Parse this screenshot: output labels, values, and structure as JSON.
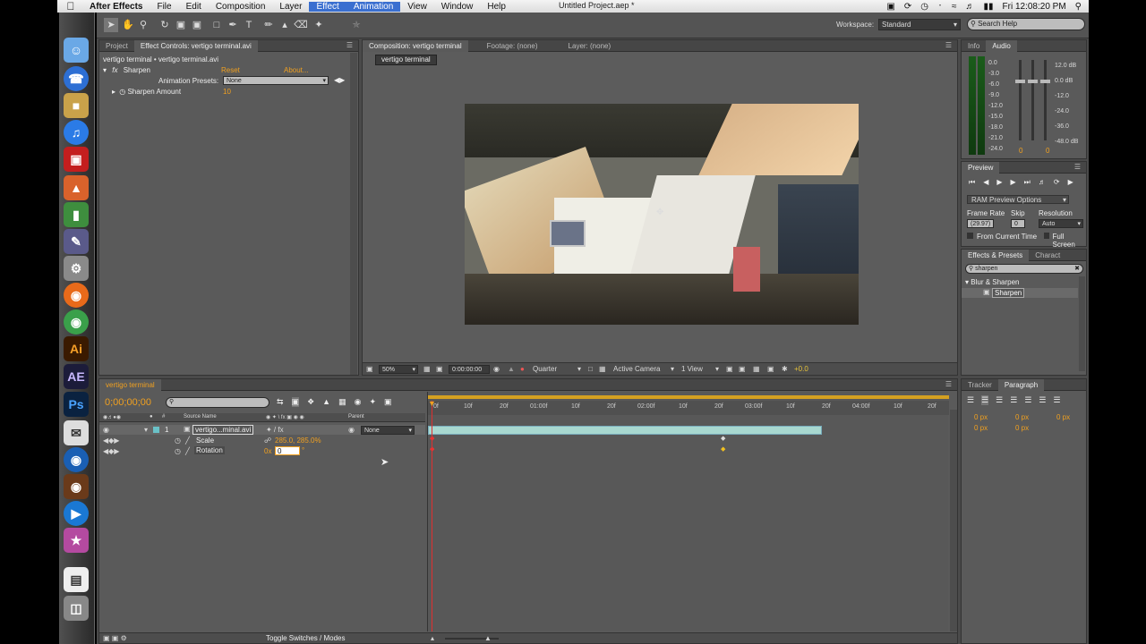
{
  "menubar": {
    "app": "After Effects",
    "menus": [
      "File",
      "Edit",
      "Composition",
      "Layer",
      "Effect",
      "Animation",
      "View",
      "Window",
      "Help"
    ],
    "active_menu": "Effect",
    "doc_title": "Untitled Project.aep *",
    "clock": "Fri 12:08:20 PM"
  },
  "toolbar": {
    "workspace_label": "Workspace:",
    "workspace_value": "Standard",
    "search_placeholder": "Search Help"
  },
  "effect_controls": {
    "tab_project": "Project",
    "tab_effect": "Effect Controls: vertigo terminal.avi",
    "path": "vertigo terminal • vertigo terminal.avi",
    "effect_name": "Sharpen",
    "reset": "Reset",
    "about": "About...",
    "presets_label": "Animation Presets:",
    "presets_value": "None",
    "param_label": "Sharpen Amount",
    "param_value": "10"
  },
  "composition": {
    "tab": "Composition: vertigo terminal",
    "footage": "Footage: (none)",
    "layer": "Layer: (none)",
    "comp_button": "vertigo terminal",
    "zoom": "50%",
    "timecode": "0:00:00:00",
    "resolution": "Quarter",
    "camera": "Active Camera",
    "view": "1 View",
    "exposure": "+0.0"
  },
  "info_audio": {
    "tab_info": "Info",
    "tab_audio": "Audio",
    "db_left": [
      "0.0",
      "-3.0",
      "-6.0",
      "-9.0",
      "-12.0",
      "-15.0",
      "-18.0",
      "-21.0",
      "-24.0"
    ],
    "db_right": [
      "12.0 dB",
      "0.0 dB",
      "-12.0",
      "-24.0",
      "-36.0",
      "-48.0 dB"
    ],
    "level_left": "0",
    "level_right": "0"
  },
  "preview": {
    "title": "Preview",
    "ram_options": "RAM Preview Options",
    "frame_rate_label": "Frame Rate",
    "skip_label": "Skip",
    "resolution_label": "Resolution",
    "frame_rate_value": "(29.97)",
    "skip_value": "0",
    "resolution_value": "Auto",
    "from_current": "From Current Time",
    "full_screen": "Full Screen"
  },
  "effects_presets": {
    "tab": "Effects & Presets",
    "tab2": "Charact",
    "search_value": "sharpen",
    "category": "Blur & Sharpen",
    "item": "Sharpen"
  },
  "paragraph": {
    "tab_tracker": "Tracker",
    "tab_paragraph": "Paragraph",
    "px1": "0 px",
    "px2": "0 px",
    "px3": "0 px",
    "px4": "0 px",
    "px5": "0 px"
  },
  "timeline": {
    "tab": "vertigo terminal",
    "timecode": "0;00;00;00",
    "col_source": "Source Name",
    "col_parent": "Parent",
    "layer_num": "1",
    "layer_name": "vertigo...minal.avi",
    "parent_value": "None",
    "scale_label": "Scale",
    "scale_value": "285.0, 285.0%",
    "rotation_label": "Rotation",
    "rotation_prefix": "0x",
    "rotation_value": "0",
    "toggle_label": "Toggle Switches / Modes",
    "ruler": [
      "0f",
      "10f",
      "20f",
      "01:00f",
      "10f",
      "20f",
      "02:00f",
      "10f",
      "20f",
      "03:00f",
      "10f",
      "20f",
      "04:00f",
      "10f",
      "20f"
    ]
  }
}
